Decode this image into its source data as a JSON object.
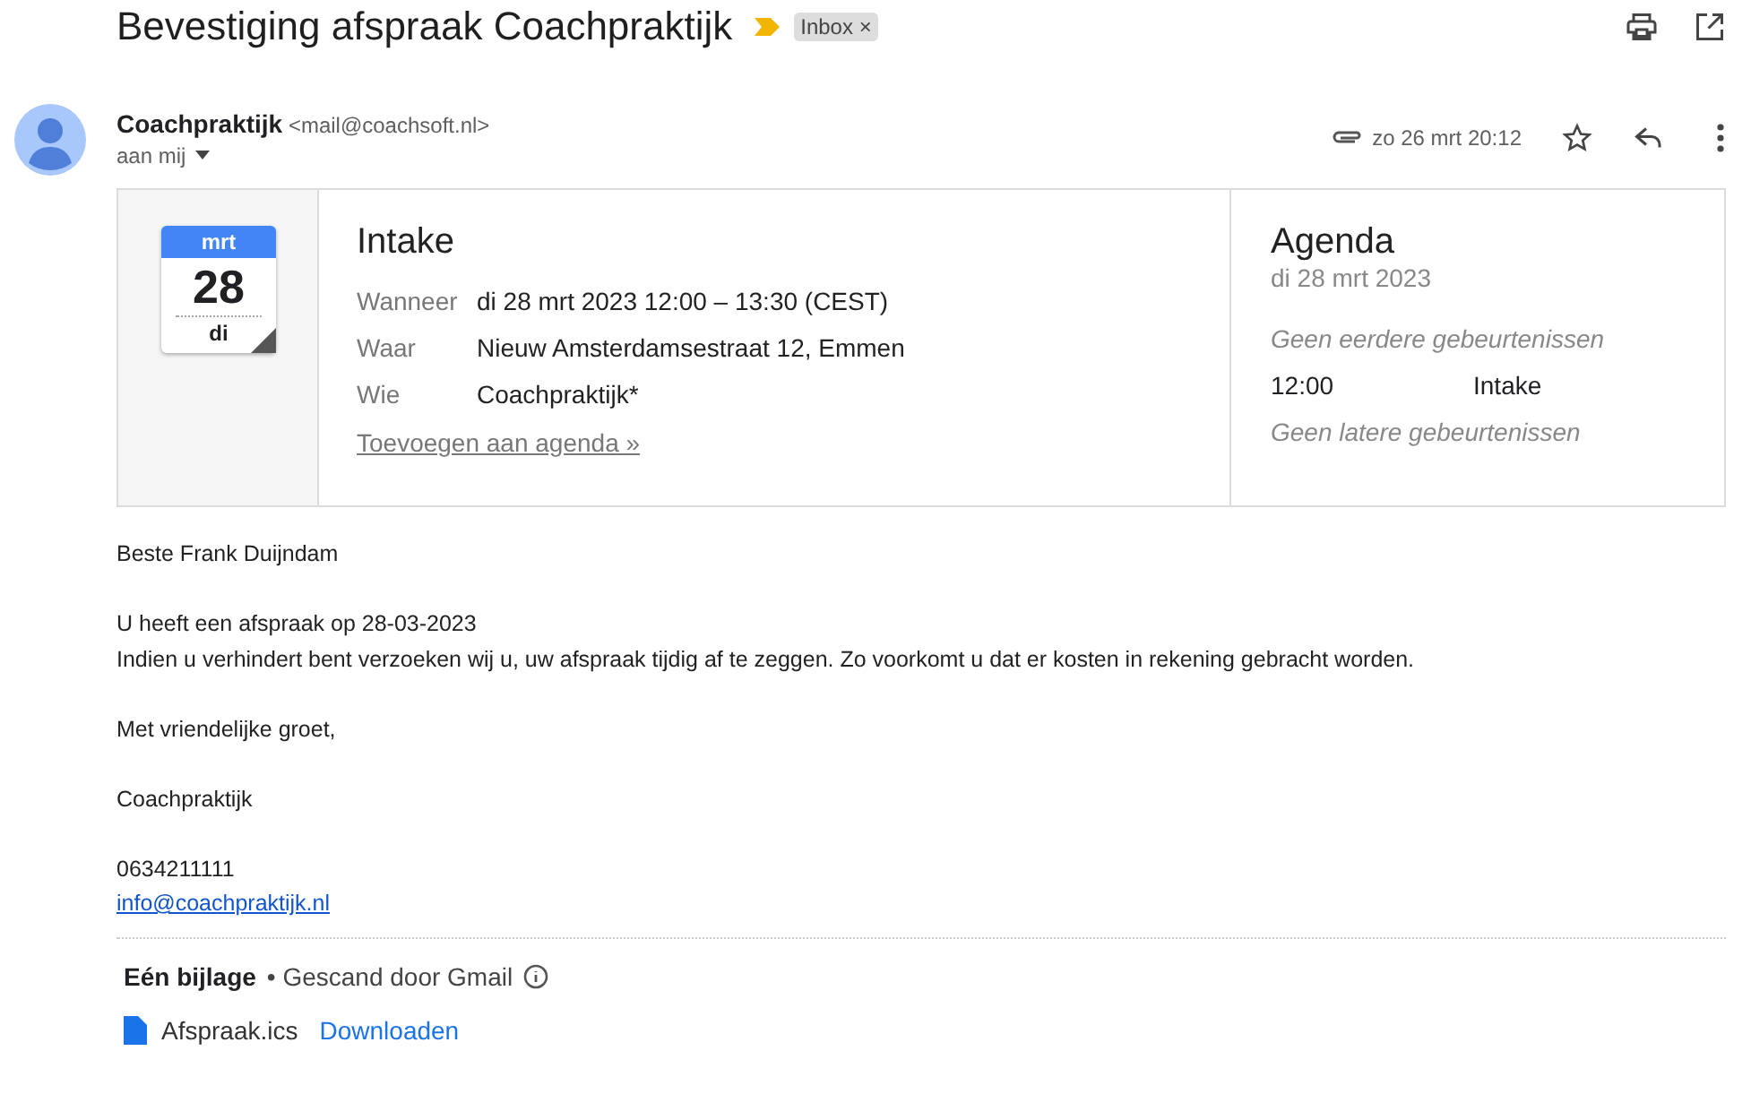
{
  "subject": "Bevestiging afspraak Coachpraktijk",
  "label": {
    "text": "Inbox",
    "close": "×"
  },
  "sender": {
    "name": "Coachpraktijk",
    "email": "<mail@coachsoft.nl>",
    "to": "aan mij",
    "date": "zo 26 mrt 20:12",
    "starred": false
  },
  "invite": {
    "month": "mrt",
    "day": "28",
    "weekday": "di",
    "title": "Intake",
    "details": [
      {
        "label": "Wanneer",
        "value": "di 28 mrt 2023 12:00 – 13:30 (CEST)"
      },
      {
        "label": "Waar",
        "value": "Nieuw Amsterdamsestraat 12, Emmen"
      },
      {
        "label": "Wie",
        "value": "Coachpraktijk*"
      }
    ],
    "add_link": "Toevoegen aan agenda »",
    "agenda": {
      "title": "Agenda",
      "date": "di 28 mrt 2023",
      "items": [
        {
          "kind": "note",
          "text": "Geen eerdere gebeurtenissen"
        },
        {
          "kind": "event",
          "time": "12:00",
          "text": "Intake"
        },
        {
          "kind": "note",
          "text": "Geen latere gebeurtenissen"
        }
      ]
    }
  },
  "body": [
    [
      {
        "kind": "text",
        "text": "Beste Frank Duijndam"
      }
    ],
    [
      {
        "kind": "text",
        "text": "U heeft een afspraak op 28-03-2023"
      },
      {
        "kind": "text",
        "text": "Indien u verhindert bent verzoeken wij u, uw afspraak tijdig af te zeggen. Zo voorkomt u dat er kosten in rekening gebracht worden."
      }
    ],
    [
      {
        "kind": "text",
        "text": "Met vriendelijke groet,"
      }
    ],
    [
      {
        "kind": "text",
        "text": "Coachpraktijk"
      }
    ],
    [
      {
        "kind": "text",
        "text": "0634211111"
      },
      {
        "kind": "link",
        "text": "info@coachpraktijk.nl"
      }
    ]
  ],
  "attachments": {
    "title": "Eén bijlage",
    "scanned": "• Gescand door Gmail",
    "files": [
      {
        "name": "Afspraak.ics",
        "action": "Downloaden"
      }
    ]
  }
}
